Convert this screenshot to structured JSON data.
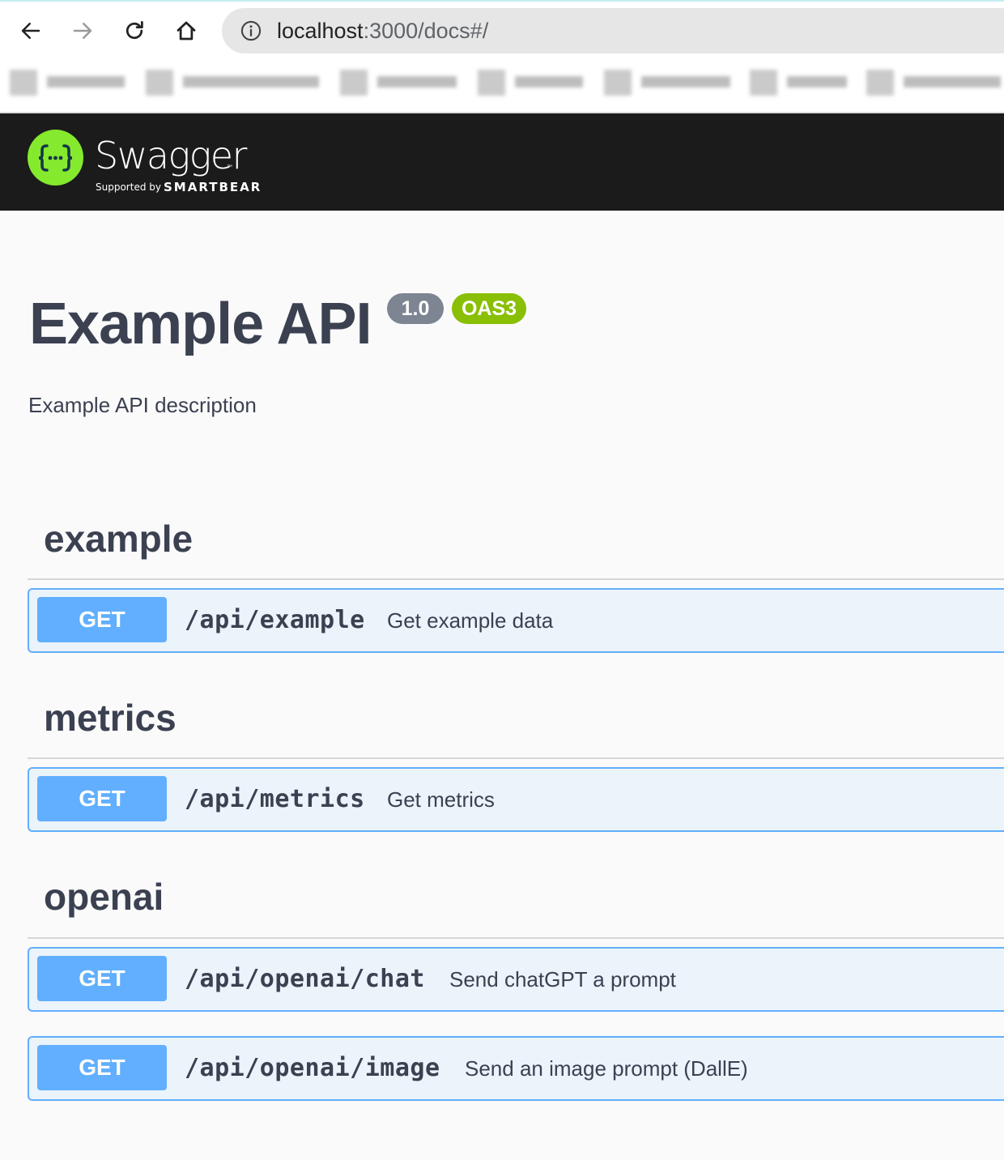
{
  "browser": {
    "url_host": "localhost",
    "url_rest": ":3000/docs#/",
    "icons": [
      "back-arrow-icon",
      "forward-arrow-icon",
      "reload-icon",
      "home-icon",
      "info-icon"
    ]
  },
  "topbar": {
    "brand": "Swagger",
    "supported_by": "Supported by",
    "company": "SMARTBEAR",
    "trademark": "™"
  },
  "info": {
    "title": "Example API",
    "version": "1.0",
    "oas": "OAS3",
    "description": "Example API description"
  },
  "tags": [
    {
      "name": "example",
      "operations": [
        {
          "method": "GET",
          "path": "/api/example",
          "summary": "Get example data"
        }
      ]
    },
    {
      "name": "metrics",
      "operations": [
        {
          "method": "GET",
          "path": "/api/metrics",
          "summary": "Get metrics"
        }
      ]
    },
    {
      "name": "openai",
      "operations": [
        {
          "method": "GET",
          "path": "/api/openai/chat",
          "summary": "Send chatGPT a prompt"
        },
        {
          "method": "GET",
          "path": "/api/openai/image",
          "summary": "Send an image prompt (DallE)"
        }
      ]
    }
  ],
  "colors": {
    "get_method": "#61affe",
    "get_bg": "#ebf3fb",
    "oas_badge": "#89bf04",
    "version_badge": "#7d8492",
    "swagger_green": "#85ea2d",
    "topbar_bg": "#1b1b1b"
  }
}
